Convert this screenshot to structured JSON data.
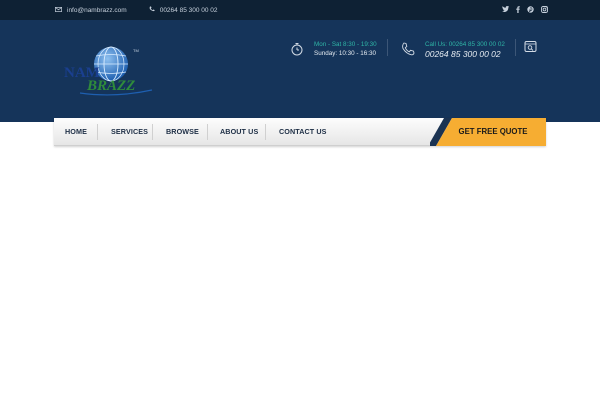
{
  "topbar": {
    "email": "info@nambrazz.com",
    "phone": "00264 85 300 00 02",
    "social_icons": [
      "twitter-icon",
      "facebook-icon",
      "pinterest-icon",
      "instagram-icon"
    ]
  },
  "logo": {
    "top_text": "NAM",
    "bottom_text": "BRAZZ",
    "colors": {
      "globe": "#1e5fb0",
      "nam": "#1a3f8f",
      "brazz": "#2f8c3b"
    }
  },
  "hours": {
    "line1": "Mon - Sat 8:30 - 19:30",
    "line2": "Sunday: 10:30 - 16:30"
  },
  "call": {
    "label": "Call Us: 00264 85 300 00 02",
    "number": "00264 85 300 00 02"
  },
  "nav": {
    "items": [
      "HOME",
      "SERVICES",
      "BROWSE",
      "ABOUT US",
      "CONTACT US"
    ],
    "quote_button": "GET FREE QUOTE"
  },
  "colors": {
    "topbar": "#0e2134",
    "header": "#15345a",
    "accent_teal": "#2fb5a6",
    "quote_orange": "#f6ad32",
    "quote_dark": "#1b3352"
  }
}
